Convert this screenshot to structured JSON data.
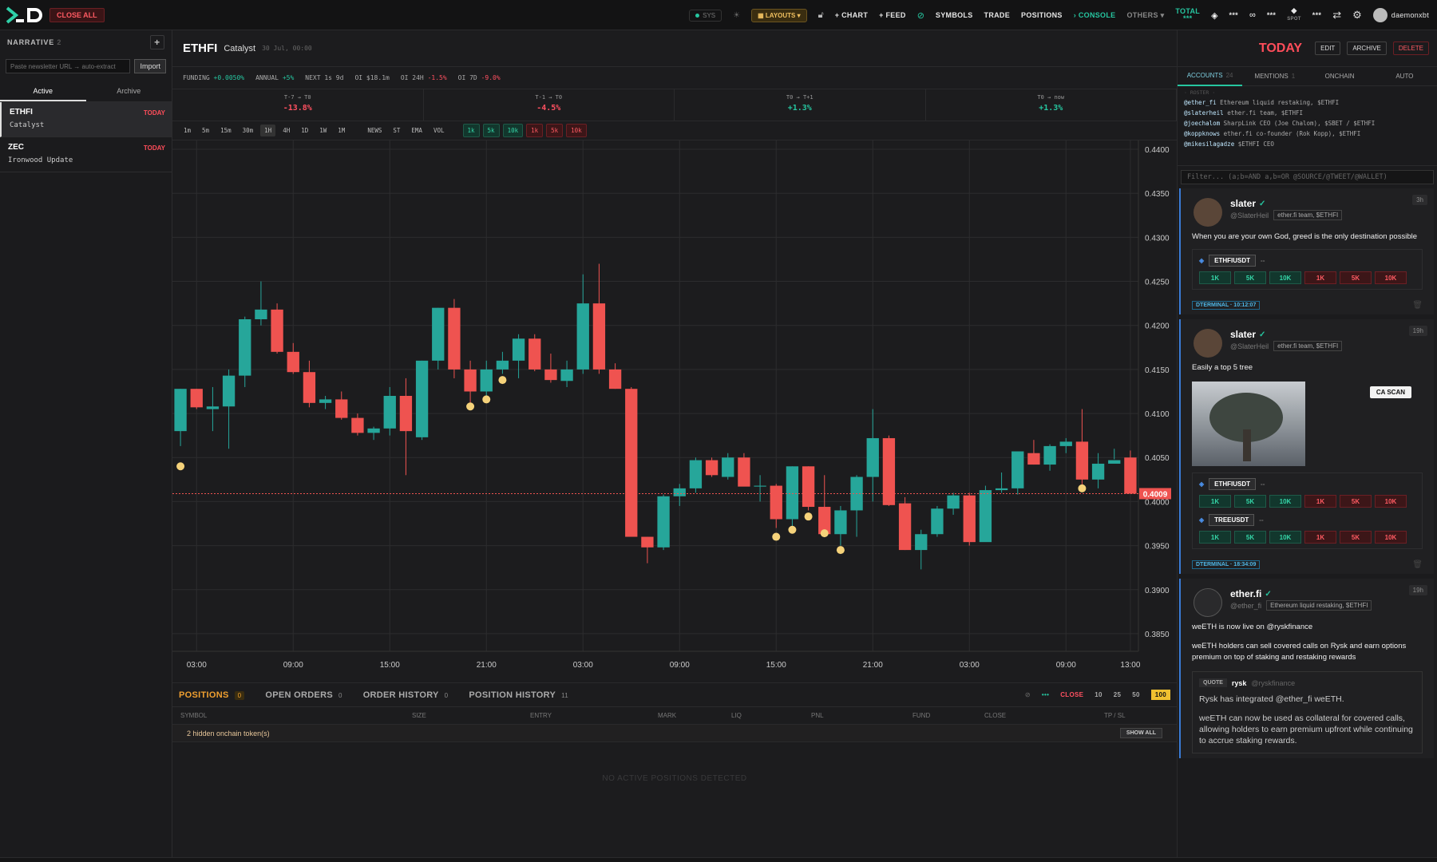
{
  "topbar": {
    "close_all": "CLOSE ALL",
    "sys": "SYS",
    "layouts": "LAYOUTS",
    "chart": "+ CHART",
    "feed": "+ FEED",
    "symbols": "SYMBOLS",
    "trade": "TRADE",
    "positions": "POSITIONS",
    "console": "CONSOLE",
    "others": "OTHERS",
    "total": "TOTAL",
    "mask1": "***",
    "mask2": "***",
    "mask3": "***",
    "mask4": "***",
    "spot": "SPOT",
    "user": "daemonxbt"
  },
  "left": {
    "title": "NARRATIVE",
    "count": "2",
    "import_placeholder": "Paste newsletter URL → auto-extract",
    "import_label": "Import",
    "tab_active": "Active",
    "tab_archive": "Archive",
    "items": [
      {
        "symbol": "ETHFI",
        "sub": "Catalyst",
        "badge": "TODAY"
      },
      {
        "symbol": "ZEC",
        "sub": "Ironwood Update",
        "badge": "TODAY"
      }
    ]
  },
  "header": {
    "symbol": "ETHFI",
    "category": "Catalyst",
    "date": "30 Jul, 00:00",
    "today": "TODAY",
    "edit": "EDIT",
    "archive": "ARCHIVE",
    "delete": "DELETE"
  },
  "funding": {
    "funding_label": "FUNDING",
    "funding_val": "+0.0050%",
    "annual_label": "ANNUAL",
    "annual_val": "+5%",
    "next_label": "NEXT",
    "next_val": "1s 9d",
    "oi_label": "OI",
    "oi_val": "$18.1m",
    "oi24_label": "OI 24H",
    "oi24_val": "-1.5%",
    "oi7_label": "OI 7D",
    "oi7_val": "-9.0%"
  },
  "perf": [
    {
      "label": "T-7 → T0",
      "value": "-13.8%",
      "dir": "down"
    },
    {
      "label": "T-1 → T0",
      "value": "-4.5%",
      "dir": "down"
    },
    {
      "label": "T0 → T+1",
      "value": "+1.3%",
      "dir": "up"
    },
    {
      "label": "T0 → now",
      "value": "+1.3%",
      "dir": "up"
    }
  ],
  "timeframes": [
    "1m",
    "5m",
    "15m",
    "30m",
    "1H",
    "4H",
    "1D",
    "1W",
    "1M"
  ],
  "active_tf": "1H",
  "indicators": [
    "NEWS",
    "ST",
    "EMA",
    "VOL"
  ],
  "size_chips": [
    {
      "label": "1k",
      "side": "buy"
    },
    {
      "label": "5k",
      "side": "buy"
    },
    {
      "label": "10k",
      "side": "buy"
    },
    {
      "label": "1k",
      "side": "sell"
    },
    {
      "label": "5k",
      "side": "sell"
    },
    {
      "label": "10k",
      "side": "sell"
    }
  ],
  "chart_data": {
    "type": "candlestick",
    "symbol": "ETHFI",
    "interval": "1H",
    "last_price": "0.4009",
    "ylim": [
      0.383,
      0.441
    ],
    "y_ticks": [
      "0.4400",
      "0.4350",
      "0.4300",
      "0.4250",
      "0.4200",
      "0.4150",
      "0.4100",
      "0.4050",
      "0.4000",
      "0.3950",
      "0.3900",
      "0.3850"
    ],
    "x_ticks": [
      "03:00",
      "09:00",
      "15:00",
      "21:00",
      "03:00",
      "09:00",
      "15:00",
      "21:00",
      "03:00",
      "09:00",
      "13:00"
    ],
    "candles": [
      [
        0.408,
        0.4128,
        0.4063,
        0.4128
      ],
      [
        0.4128,
        0.4128,
        0.4105,
        0.4107
      ],
      [
        0.4105,
        0.413,
        0.408,
        0.4108
      ],
      [
        0.4108,
        0.415,
        0.406,
        0.4143
      ],
      [
        0.4143,
        0.421,
        0.413,
        0.4207
      ],
      [
        0.4207,
        0.425,
        0.42,
        0.4218
      ],
      [
        0.4218,
        0.4225,
        0.4168,
        0.417
      ],
      [
        0.417,
        0.418,
        0.4145,
        0.4147
      ],
      [
        0.4147,
        0.416,
        0.4107,
        0.4112
      ],
      [
        0.4112,
        0.412,
        0.4105,
        0.4116
      ],
      [
        0.4116,
        0.4125,
        0.4093,
        0.4095
      ],
      [
        0.4095,
        0.41,
        0.4075,
        0.4078
      ],
      [
        0.4078,
        0.4085,
        0.407,
        0.4083
      ],
      [
        0.4083,
        0.413,
        0.4075,
        0.412
      ],
      [
        0.412,
        0.414,
        0.403,
        0.408
      ],
      [
        0.4073,
        0.416,
        0.407,
        0.416
      ],
      [
        0.416,
        0.422,
        0.415,
        0.422
      ],
      [
        0.422,
        0.423,
        0.414,
        0.415
      ],
      [
        0.415,
        0.416,
        0.411,
        0.4125
      ],
      [
        0.4125,
        0.416,
        0.412,
        0.415
      ],
      [
        0.415,
        0.417,
        0.4145,
        0.416
      ],
      [
        0.416,
        0.419,
        0.414,
        0.4185
      ],
      [
        0.4185,
        0.419,
        0.4148,
        0.415
      ],
      [
        0.415,
        0.4168,
        0.4135,
        0.4138
      ],
      [
        0.4137,
        0.416,
        0.413,
        0.415
      ],
      [
        0.415,
        0.4258,
        0.4145,
        0.4225
      ],
      [
        0.4225,
        0.427,
        0.4145,
        0.415
      ],
      [
        0.415,
        0.4157,
        0.4128,
        0.4128
      ],
      [
        0.4128,
        0.413,
        0.396,
        0.396
      ],
      [
        0.396,
        0.396,
        0.393,
        0.3948
      ],
      [
        0.3948,
        0.4008,
        0.3945,
        0.4006
      ],
      [
        0.4006,
        0.402,
        0.3995,
        0.4015
      ],
      [
        0.4015,
        0.405,
        0.401,
        0.4047
      ],
      [
        0.4047,
        0.405,
        0.4028,
        0.403
      ],
      [
        0.4028,
        0.4055,
        0.4025,
        0.405
      ],
      [
        0.405,
        0.4055,
        0.4018,
        0.4017
      ],
      [
        0.4017,
        0.403,
        0.4,
        0.4018
      ],
      [
        0.4018,
        0.402,
        0.397,
        0.398
      ],
      [
        0.398,
        0.404,
        0.397,
        0.404
      ],
      [
        0.404,
        0.404,
        0.399,
        0.3994
      ],
      [
        0.3994,
        0.403,
        0.396,
        0.3963
      ],
      [
        0.3963,
        0.3995,
        0.395,
        0.399
      ],
      [
        0.399,
        0.403,
        0.396,
        0.4028
      ],
      [
        0.4028,
        0.4105,
        0.4,
        0.4072
      ],
      [
        0.4072,
        0.4075,
        0.3995,
        0.3996
      ],
      [
        0.3998,
        0.4005,
        0.3945,
        0.3945
      ],
      [
        0.3945,
        0.3968,
        0.3923,
        0.3963
      ],
      [
        0.3963,
        0.3995,
        0.396,
        0.3992
      ],
      [
        0.3992,
        0.401,
        0.3985,
        0.4007
      ],
      [
        0.4007,
        0.401,
        0.395,
        0.3954
      ],
      [
        0.3954,
        0.4018,
        0.3955,
        0.4013
      ],
      [
        0.4013,
        0.4033,
        0.401,
        0.4015
      ],
      [
        0.4015,
        0.4055,
        0.4008,
        0.4057
      ],
      [
        0.4055,
        0.407,
        0.4042,
        0.4042
      ],
      [
        0.4042,
        0.4065,
        0.4035,
        0.4063
      ],
      [
        0.4063,
        0.4072,
        0.4055,
        0.4068
      ],
      [
        0.4068,
        0.4105,
        0.4015,
        0.4025
      ],
      [
        0.4025,
        0.4055,
        0.4015,
        0.4043
      ],
      [
        0.4043,
        0.406,
        0.4048,
        0.4047
      ],
      [
        0.405,
        0.4058,
        0.401,
        0.4009
      ]
    ],
    "markers": [
      {
        "index": 0,
        "price": 0.404
      },
      {
        "index": 18,
        "price": 0.4108
      },
      {
        "index": 19,
        "price": 0.4116
      },
      {
        "index": 20,
        "price": 0.4138
      },
      {
        "index": 37,
        "price": 0.396
      },
      {
        "index": 38,
        "price": 0.3968
      },
      {
        "index": 39,
        "price": 0.3983
      },
      {
        "index": 40,
        "price": 0.3964
      },
      {
        "index": 41,
        "price": 0.3945
      },
      {
        "index": 56,
        "price": 0.4015
      }
    ]
  },
  "positions": {
    "tabs": [
      {
        "label": "POSITIONS",
        "count": "0"
      },
      {
        "label": "OPEN ORDERS",
        "count": "0"
      },
      {
        "label": "ORDER HISTORY",
        "count": "0"
      },
      {
        "label": "POSITION HISTORY",
        "count": "11"
      }
    ],
    "close": "CLOSE",
    "close_pcts": [
      "10",
      "25",
      "50",
      "100"
    ],
    "mask": "•••",
    "columns": [
      "SYMBOL",
      "SIZE",
      "ENTRY",
      "MARK",
      "LIQ",
      "PNL",
      "FUND",
      "CLOSE",
      "TP / SL"
    ],
    "hidden_tokens": "2 hidden onchain token(s)",
    "show_all": "SHOW ALL",
    "empty": "NO ACTIVE POSITIONS DETECTED"
  },
  "right": {
    "tabs": [
      {
        "label": "ACCOUNTS",
        "count": "24"
      },
      {
        "label": "MENTIONS",
        "count": "1"
      },
      {
        "label": "ONCHAIN",
        "count": ""
      },
      {
        "label": "AUTO",
        "count": ""
      }
    ],
    "roster_title": "· ROSTER ·",
    "roster": [
      {
        "handle": "@ether_fi",
        "desc": "Ethereum liquid restaking, $ETHFI"
      },
      {
        "handle": "@slaterheil",
        "desc": "ether.fi team, $ETHFI"
      },
      {
        "handle": "@joechalom",
        "desc": "SharpLink CEO (Joe Chalom), $SBET / $ETHFI"
      },
      {
        "handle": "@koppknows",
        "desc": "ether.fi co-founder (Rok Kopp), $ETHFI"
      },
      {
        "handle": "@mikesilagadze",
        "desc": "$ETHFI CEO"
      }
    ],
    "filter_placeholder": "Filter... (a;b=AND a,b=OR @SOURCE/@TWEET/@WALLET)",
    "amounts": [
      "1K",
      "5K",
      "10K",
      "1K",
      "5K",
      "10K"
    ],
    "cards": [
      {
        "name": "slater",
        "handle": "@SlaterHeil",
        "tag": "ether.fi team, $ETHFI",
        "age": "3h",
        "text": "When you are your own God, greed is the only destination possible",
        "tokens": [
          {
            "name": "ETHFIUSDT",
            "chg": "--"
          }
        ],
        "stamp": "DTERMINAL · 10:12:07"
      },
      {
        "name": "slater",
        "handle": "@SlaterHeil",
        "tag": "ether.fi team, $ETHFI",
        "age": "19h",
        "text": "Easily a top 5 tree",
        "scan": "CA SCAN",
        "tokens": [
          {
            "name": "ETHFIUSDT",
            "chg": "--"
          },
          {
            "name": "TREEUSDT",
            "chg": "--"
          }
        ],
        "stamp": "DTERMINAL · 18:34:09"
      },
      {
        "name": "ether.fi",
        "handle": "@ether_fi",
        "tag": "Ethereum liquid restaking, $ETHFI",
        "age": "19h",
        "text": "weETH is now live on @ryskfinance",
        "text2": "weETH holders can sell covered calls on Rysk and earn options premium on top of staking and restaking rewards",
        "quote_badge": "QUOTE",
        "quote_name": "rysk",
        "quote_handle": "@ryskfinance",
        "quote_text": "Rysk has integrated @ether_fi weETH.",
        "quote_text2": "weETH can now be used as collateral for covered calls, allowing holders to earn premium upfront while continuing to accrue staking rewards."
      }
    ]
  },
  "colors": {
    "up": "#26a69a",
    "down": "#ef5350",
    "accent": "#f0a030",
    "brand_red": "#ff4d5a"
  }
}
